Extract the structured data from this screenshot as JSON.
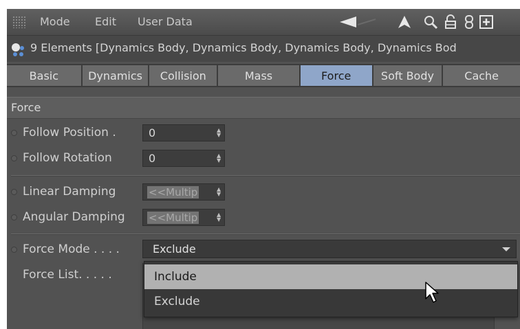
{
  "menubar": {
    "items": [
      "Mode",
      "Edit",
      "User Data"
    ],
    "icons": [
      "back-arrow-icon",
      "up-arrow-icon",
      "search-icon",
      "lock-icon",
      "link-icon",
      "new-panel-icon"
    ]
  },
  "object": {
    "title": "9 Elements [Dynamics Body, Dynamics Body, Dynamics Body, Dynamics Bod"
  },
  "tabs": [
    {
      "label": "Basic",
      "active": false
    },
    {
      "label": "Dynamics",
      "active": false
    },
    {
      "label": "Collision",
      "active": false
    },
    {
      "label": "Mass",
      "active": false
    },
    {
      "label": "Force",
      "active": true
    },
    {
      "label": "Soft Body",
      "active": false
    },
    {
      "label": "Cache",
      "active": false
    }
  ],
  "section": {
    "title": "Force"
  },
  "properties": {
    "follow_position": {
      "label": "Follow Position .",
      "value": "0"
    },
    "follow_rotation": {
      "label": "Follow Rotation",
      "value": "0"
    },
    "linear_damping": {
      "label": "Linear Damping",
      "value": "<<Multip"
    },
    "angular_damping": {
      "label": "Angular Damping",
      "value": "<<Multip"
    },
    "force_mode": {
      "label": "Force Mode . . . .",
      "value": "Exclude"
    },
    "force_list": {
      "label": "Force List. . . . ."
    }
  },
  "dropdown_options": [
    {
      "label": "Include",
      "highlighted": true
    },
    {
      "label": "Exclude",
      "highlighted": false
    }
  ],
  "colors": {
    "active_tab": "#8fa6c9",
    "panel_bg": "#525252",
    "highlight": "#b1b1b1"
  }
}
